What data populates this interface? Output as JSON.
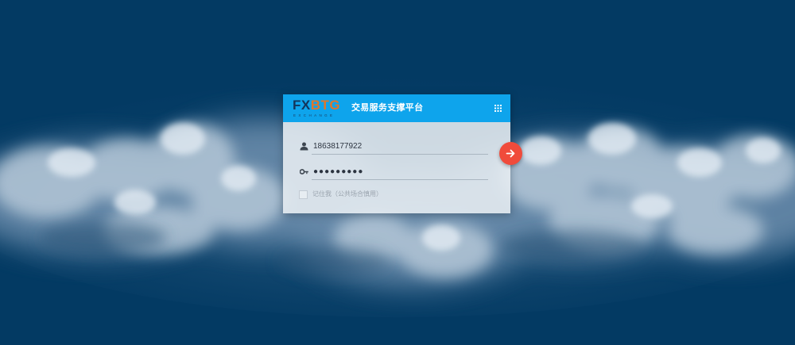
{
  "brand": {
    "logo_fx": "FX",
    "logo_btg": "BTG",
    "logo_sub": "EXCHANGE",
    "platform_title": "交易服务支撑平台",
    "header_color": "#0ea4ec"
  },
  "login": {
    "username_value": "18638177922",
    "password_value": "●●●●●●●●●",
    "remember_label": "记住我（公共场合慎用）",
    "remember_checked": false,
    "user_icon": "user-icon",
    "password_icon": "key-icon",
    "submit_icon": "arrow-right-icon",
    "submit_color": "#f04b3b"
  },
  "header_actions": {
    "apps_icon": "apps-grid-icon"
  },
  "background": {
    "color": "#033a63",
    "description_icon": "clouds-background"
  }
}
